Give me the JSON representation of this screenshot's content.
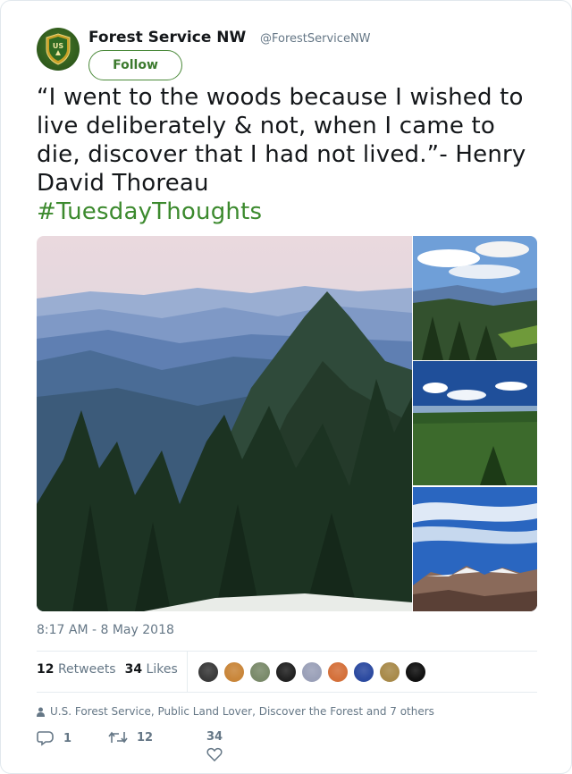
{
  "author": {
    "name": "Forest Service NW",
    "handle": "@ForestServiceNW",
    "avatar_icon": "us-forest-service-shield-icon"
  },
  "follow_label": "Follow",
  "tweet": {
    "text": "“I went to the woods because I wished to live deliberately & not, when I came to die, discover that I had not lived.”- Henry David Thoreau",
    "hashtag": "#TuesdayThoughts"
  },
  "media": [
    {
      "icon": "mountain-forest-photo"
    },
    {
      "icon": "valley-clouds-photo"
    },
    {
      "icon": "plateau-forest-photo"
    },
    {
      "icon": "snowy-ridge-photo"
    }
  ],
  "timestamp": "8:17 AM - 8 May 2018",
  "stats": {
    "retweets_count": "12",
    "retweets_label": "Retweets",
    "likes_count": "34",
    "likes_label": "Likes"
  },
  "likers": [
    {
      "color": "#3a3a3a"
    },
    {
      "color": "#c9863a"
    },
    {
      "color": "#7a8a6a"
    },
    {
      "color": "#222222"
    },
    {
      "color": "#9aa0b8"
    },
    {
      "color": "#d4703a"
    },
    {
      "color": "#2c4aa0"
    },
    {
      "color": "#a88a4a"
    },
    {
      "color": "#111111"
    }
  ],
  "context_text": "U.S. Forest Service, Public Land Lover, Discover the Forest and 7 others",
  "actions": {
    "reply_count": "1",
    "retweet_count": "12",
    "like_count": "34"
  },
  "colors": {
    "accent": "#3c8a2e",
    "secondary_text": "#657786"
  }
}
